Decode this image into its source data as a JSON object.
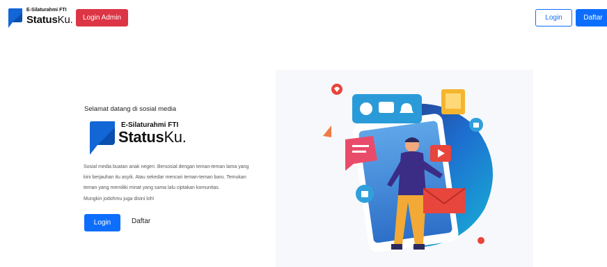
{
  "navbar": {
    "brand_sub": "E-Silaturahmi FTI",
    "brand_bold": "Status",
    "brand_light": "Ku.",
    "admin_button": "Login Admin",
    "login_button": "Login",
    "register_button": "Daftar"
  },
  "hero": {
    "greeting": "Selamat datang di sosial media",
    "logo_sub": "E-Silaturahmi FTI",
    "logo_bold": "Status",
    "logo_light": "Ku.",
    "description_lines": [
      "Sosial media buatan anak negeri. Bersosial dengan teman-teman lama yang",
      "kini berjauhan itu asyik. Atau sekedar mencari teman-teman baru. Temukan",
      "teman yang memiliki minat yang sama lalu ciptakan komunitas.",
      "Mungkin jodohmu juga disini loh!"
    ],
    "login_button": "Login",
    "register_link": "Daftar"
  },
  "colors": {
    "primary": "#0d6efd",
    "danger": "#dc3545",
    "logo_blue": "#1266d6"
  },
  "illustration": {
    "icons": [
      "heart-icon",
      "user-icon",
      "chat-icon",
      "bell-icon",
      "image-icon",
      "thumbs-up-icon",
      "music-note-icon",
      "video-play-icon",
      "mail-icon",
      "person-figure"
    ]
  }
}
